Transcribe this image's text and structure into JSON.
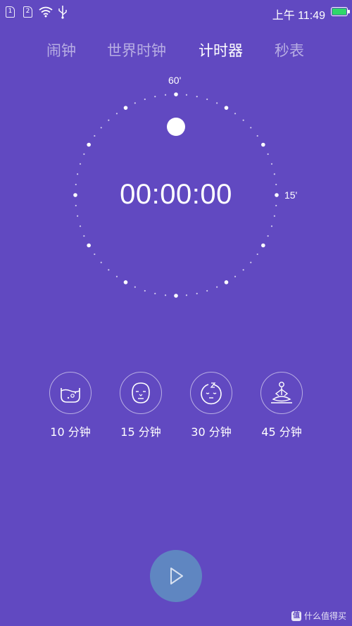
{
  "status_bar": {
    "sim1_label": "1",
    "sim2_label": "2",
    "time": "上午 11:49",
    "wifi_icon": "wifi-icon",
    "usb_icon": "usb-icon",
    "battery_color": "#2fd86a"
  },
  "tabs": [
    {
      "label": "闹钟",
      "active": false
    },
    {
      "label": "世界时钟",
      "active": false
    },
    {
      "label": "计时器",
      "active": true
    },
    {
      "label": "秒表",
      "active": false
    }
  ],
  "timer": {
    "display": "00:00:00",
    "label_top": "60'",
    "label_right": "15'"
  },
  "presets": [
    {
      "label": "10 分钟",
      "icon": "washbasin-icon"
    },
    {
      "label": "15 分钟",
      "icon": "face-mask-icon"
    },
    {
      "label": "30 分钟",
      "icon": "sleeping-face-icon"
    },
    {
      "label": "45 分钟",
      "icon": "meditation-icon"
    }
  ],
  "start_button": {
    "icon": "play-icon",
    "color": "#5f86c1"
  },
  "watermark": {
    "badge": "值",
    "text": "什么值得买"
  },
  "colors": {
    "background": "#6149c1",
    "accent": "#ffffff"
  }
}
